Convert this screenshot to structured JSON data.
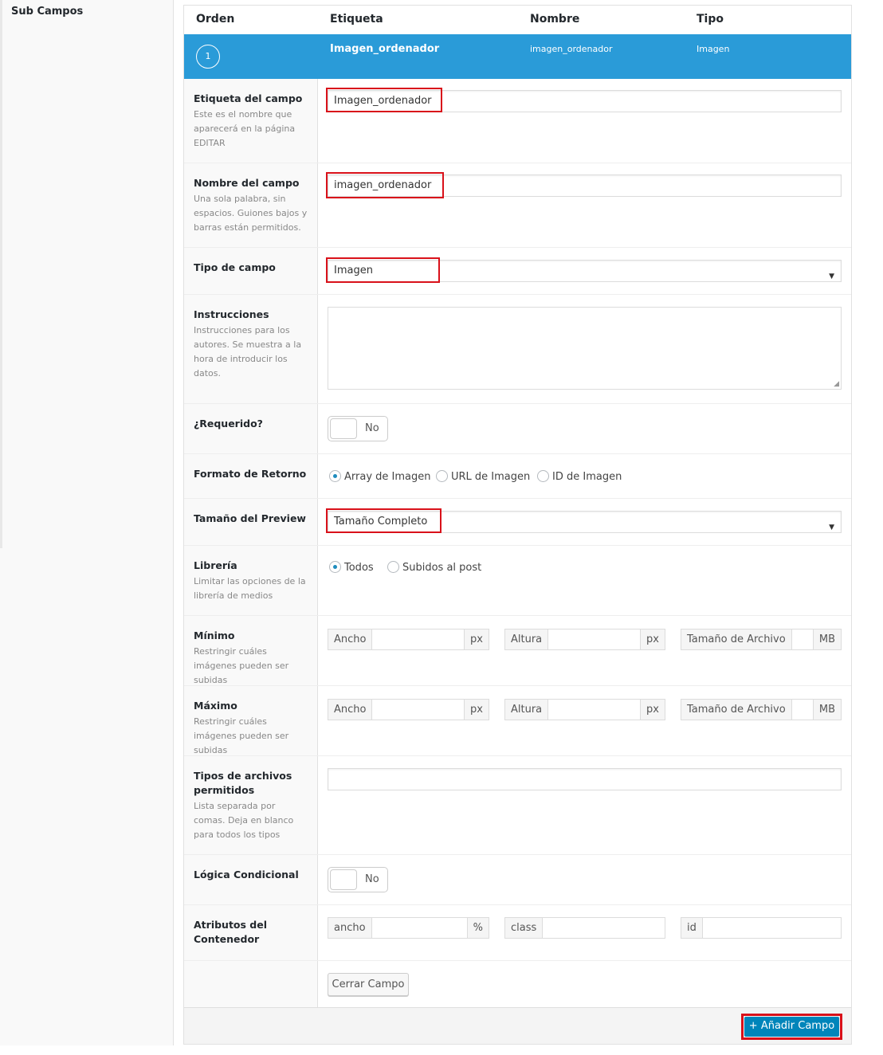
{
  "sidebar": {
    "title": "Sub Campos"
  },
  "table_header": {
    "orden": "Orden",
    "etiqueta": "Etiqueta",
    "nombre": "Nombre",
    "tipo": "Tipo"
  },
  "field": {
    "order": "1",
    "label": "Imagen_ordenador",
    "name": "imagen_ordenador",
    "type": "Imagen"
  },
  "rows": {
    "etiqueta": {
      "title": "Etiqueta del campo",
      "desc": "Este es el nombre que aparecerá en la página EDITAR",
      "value": "Imagen_ordenador"
    },
    "nombre": {
      "title": "Nombre del campo",
      "desc": "Una sola palabra, sin espacios. Guiones bajos y barras están permitidos.",
      "value": "imagen_ordenador"
    },
    "tipo": {
      "title": "Tipo de campo",
      "value": "Imagen"
    },
    "instrucciones": {
      "title": "Instrucciones",
      "desc": "Instrucciones para los autores. Se muestra a la hora de introducir los datos.",
      "value": ""
    },
    "requerido": {
      "title": "¿Requerido?",
      "toggle": "No"
    },
    "formato": {
      "title": "Formato de Retorno",
      "options": [
        "Array de Imagen",
        "URL de Imagen",
        "ID de Imagen"
      ],
      "selected": "Array de Imagen"
    },
    "preview": {
      "title": "Tamaño del Preview",
      "value": "Tamaño Completo"
    },
    "libreria": {
      "title": "Librería",
      "desc": "Limitar las opciones de la librería de medios",
      "options": [
        "Todos",
        "Subidos al post"
      ],
      "selected": "Todos"
    },
    "minimo": {
      "title": "Mínimo",
      "desc": "Restringir cuáles imágenes pueden ser subidas",
      "ancho": "Ancho",
      "altura": "Altura",
      "tamano": "Tamaño de Archivo",
      "px": "px",
      "mb": "MB"
    },
    "maximo": {
      "title": "Máximo",
      "desc": "Restringir cuáles imágenes pueden ser subidas",
      "ancho": "Ancho",
      "altura": "Altura",
      "tamano": "Tamaño de Archivo",
      "px": "px",
      "mb": "MB"
    },
    "tipos": {
      "title": "Tipos de archivos permitidos",
      "desc": "Lista separada por comas. Deja en blanco para todos los tipos",
      "value": ""
    },
    "logica": {
      "title": "Lógica Condicional",
      "toggle": "No"
    },
    "atributos": {
      "title": "Atributos del Contenedor",
      "ancho": "ancho",
      "pct": "%",
      "class": "class",
      "id": "id"
    }
  },
  "buttons": {
    "close": "Cerrar Campo",
    "add": "+ Añadir Campo"
  },
  "colors": {
    "header_blue": "#2a9bd8",
    "primary_button": "#0085ba",
    "highlight_red": "#d9111a"
  }
}
